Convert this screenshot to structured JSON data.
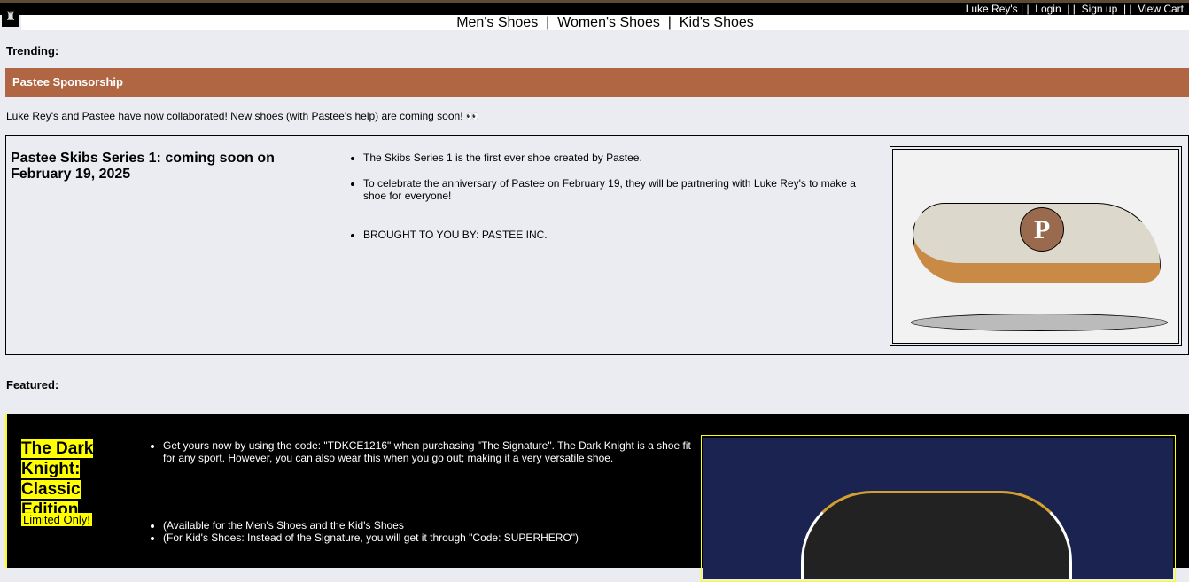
{
  "header": {
    "logo": "logo",
    "links": [
      "Luke Rey's",
      "Login",
      "Sign up",
      "View Cart"
    ],
    "separator": "| |"
  },
  "nav": {
    "items": [
      "Men's Shoes",
      "Women's Shoes",
      "Kid's Shoes"
    ],
    "separator": "|"
  },
  "trending": {
    "label": "Trending:",
    "banner": "Pastee Sponsorship",
    "intro": "Luke Rey's and Pastee have now collaborated! New shoes (with Pastee's help) are coming soon! 👀",
    "title": "Pastee Skibs Series 1: coming soon on February 19, 2025",
    "bullets": [
      "The Skibs Series 1 is the first ever shoe created by Pastee.",
      "To celebrate the anniversary of Pastee on February 19, they will be partnering with Luke Rey's to make a shoe for everyone!",
      "BROUGHT TO YOU BY: PASTEE INC."
    ],
    "image_logo": "P"
  },
  "featured": {
    "label": "Featured:",
    "title": "The Dark Knight: Classic Edition",
    "badge": "Limited Only!",
    "bullets1": [
      "Get yours now by using the code: \"TDKCE1216\" when purchasing \"The Signature\". The Dark Knight is a shoe fit for any sport. However, you can also wear this when you go out; making it a very versatile shoe."
    ],
    "bullets2": [
      "(Available for the Men's Shoes and the Kid's Shoes",
      "(For Kid's Shoes: Instead of the Signature, you will get it through \"Code: SUPERHERO\")"
    ]
  },
  "colors": {
    "banner": "#b06643",
    "accent": "#ffff00",
    "background": "#ebecf1"
  }
}
